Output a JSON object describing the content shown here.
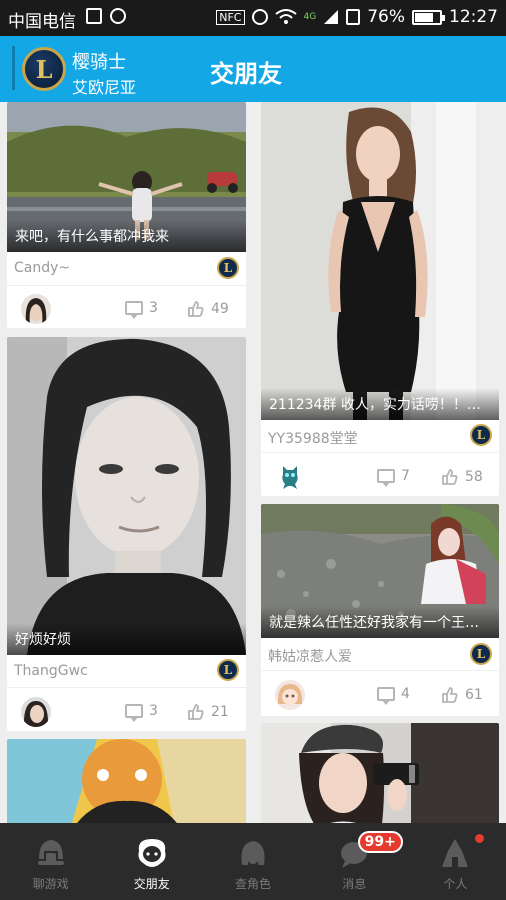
{
  "status_bar": {
    "carrier": "中国电信",
    "nfc": "NFC",
    "network": "4G",
    "battery_percent": "76%",
    "battery_level": 0.76,
    "time": "12:27"
  },
  "header": {
    "logo_letter": "L",
    "username": "樱骑士",
    "server": "艾欧尼亚",
    "title": "交朋友"
  },
  "feed": {
    "cards": [
      {
        "caption": "来吧，有什么事都冲我来",
        "author": "Candy~",
        "comments": "3",
        "likes": "49",
        "game_badge": "L"
      },
      {
        "caption": "211234群  收人，实力话唠！！带...",
        "author": "YY35988堂堂",
        "comments": "7",
        "likes": "58",
        "game_badge": "L"
      },
      {
        "caption": "好烦好烦",
        "author": "ThangGwc",
        "comments": "3",
        "likes": "21",
        "game_badge": "L"
      },
      {
        "caption": "就是辣么任性还好我家有一个王者...",
        "author": "韩姑凉惹人爱",
        "comments": "4",
        "likes": "61",
        "game_badge": "L"
      }
    ]
  },
  "tabs": [
    {
      "label": "聊游戏",
      "icon": "helmet-icon"
    },
    {
      "label": "交朋友",
      "icon": "friends-icon"
    },
    {
      "label": "查角色",
      "icon": "character-icon"
    },
    {
      "label": "消息",
      "icon": "message-icon",
      "badge": "99+"
    },
    {
      "label": "个人",
      "icon": "profile-icon"
    }
  ],
  "colors": {
    "header_bg": "#14a7e6",
    "tabbar_bg": "#2b2b2b",
    "badge_red": "#e53a2e"
  }
}
